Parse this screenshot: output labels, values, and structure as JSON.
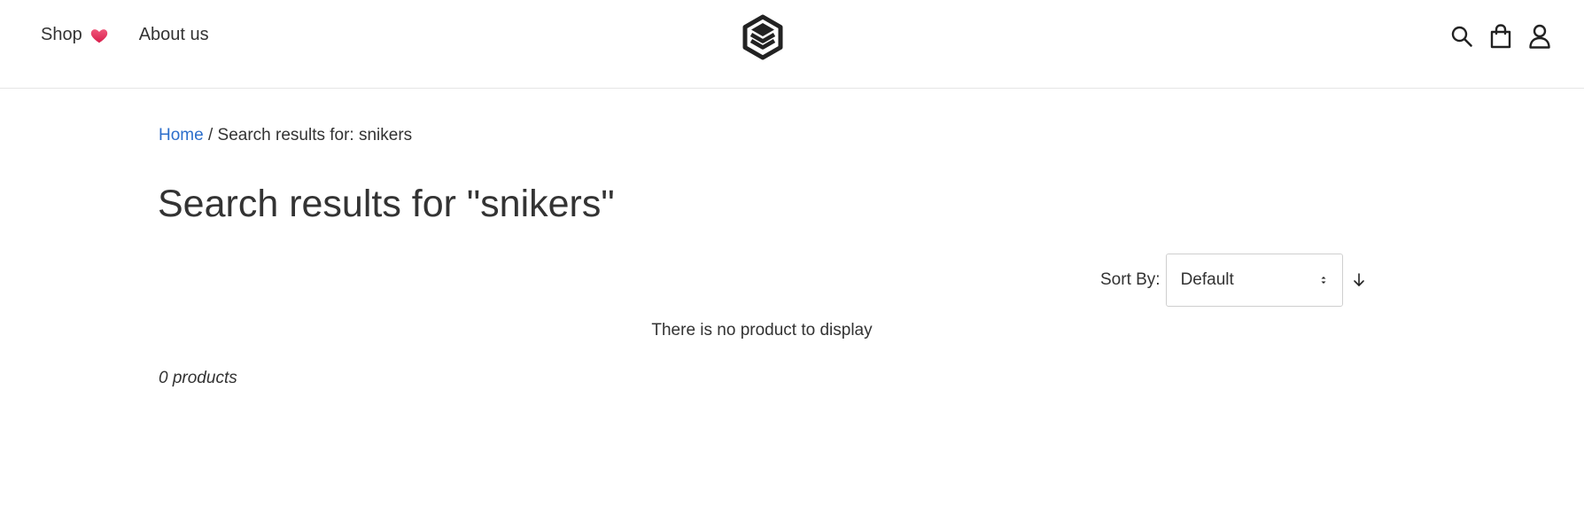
{
  "header": {
    "nav": [
      {
        "label": "Shop"
      },
      {
        "label": "About us"
      }
    ],
    "logo_icon": "layered-hexagon-logo",
    "right_icons": [
      "search-icon",
      "shopping-bag-icon",
      "user-icon"
    ]
  },
  "breadcrumb": {
    "home_label": "Home",
    "separator": " / ",
    "current": "Search results for: snikers"
  },
  "page": {
    "title": "Search results for \"snikers\""
  },
  "sort": {
    "label": "Sort By:",
    "selected": "Default"
  },
  "results": {
    "empty_message": "There is no product to display",
    "count_label": "0 products"
  },
  "colors": {
    "link": "#2c6ecb",
    "text": "#333333",
    "heart": "#e8345a",
    "border": "#cfcfcf"
  }
}
